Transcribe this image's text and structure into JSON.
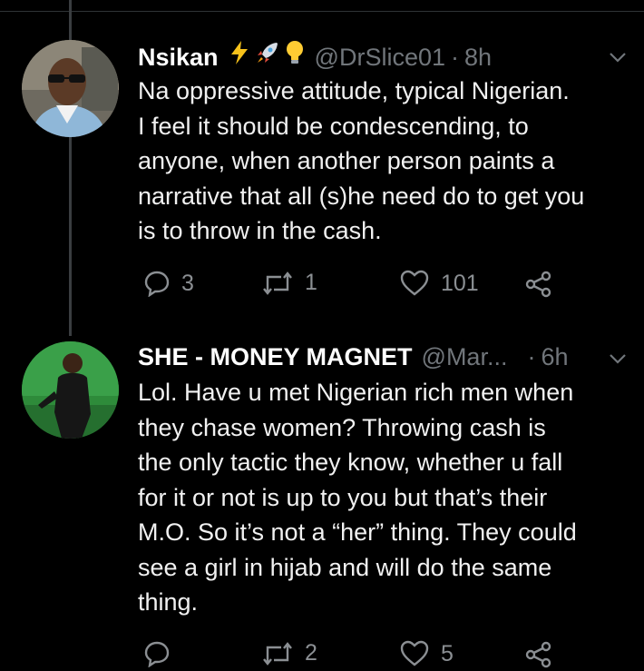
{
  "tweets": [
    {
      "name": "Nsikan",
      "emojis": [
        "lightning-icon",
        "rocket-icon",
        "bulb-icon"
      ],
      "handle": "@DrSlice01",
      "separator": "·",
      "time": "8h",
      "lines": [
        "Na oppressive attitude, typical Nigerian.",
        "I feel it should be condescending, to",
        "anyone, when another person paints a",
        "narrative that all (s)he need do to get you",
        "is to throw in the cash."
      ],
      "replies": "3",
      "retweets": "1",
      "likes": "101"
    },
    {
      "name": "SHE - MONEY MAGNET",
      "handle": "@Mar...",
      "separator": "·",
      "time": "6h",
      "lines": [
        "Lol. Have u met Nigerian rich men when",
        "they chase women? Throwing cash is",
        "the only tactic they know, whether u fall",
        "for it or not is up to you but that’s their",
        "M.O. So it’s not a “her” thing. They could",
        "see a girl in hijab and will do the same",
        "thing."
      ],
      "replies": "",
      "retweets": "2",
      "likes": "5"
    }
  ]
}
